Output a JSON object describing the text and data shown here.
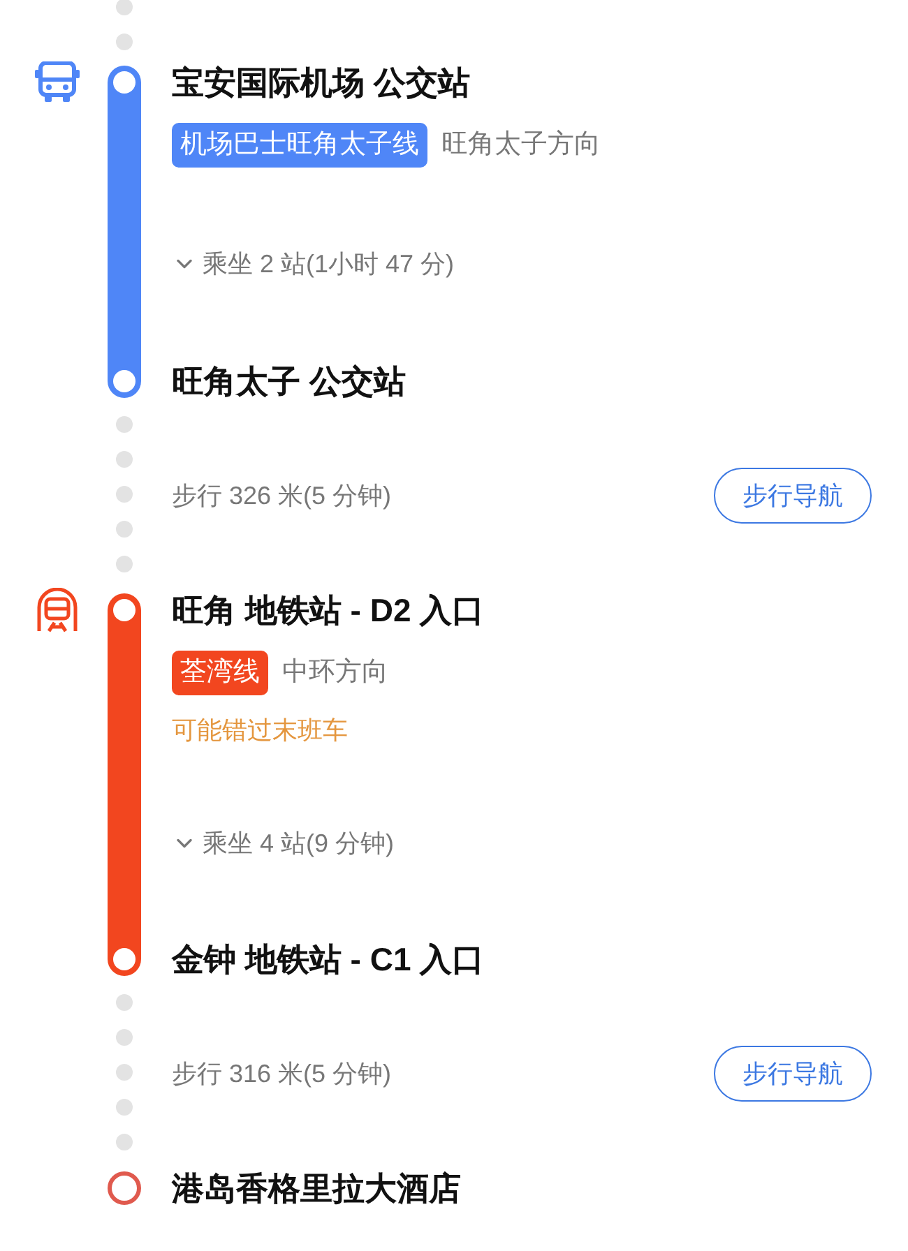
{
  "segments": [
    {
      "kind": "connector"
    },
    {
      "kind": "bus",
      "color": "#4f86f7",
      "from": "宝安国际机场 公交站",
      "line": "机场巴士旺角太子线",
      "direction": "旺角太子方向",
      "ride": "乘坐 2 站(1小时 47 分)",
      "to": "旺角太子 公交站"
    },
    {
      "kind": "walk",
      "text": "步行 326 米(5 分钟)",
      "button": "步行导航"
    },
    {
      "kind": "subway",
      "color": "#f2461f",
      "from": "旺角 地铁站 - D2 入口",
      "line": "荃湾线",
      "direction": "中环方向",
      "warning": "可能错过末班车",
      "ride": "乘坐 4 站(9 分钟)",
      "to": "金钟 地铁站 - C1 入口"
    },
    {
      "kind": "walk",
      "text": "步行 316 米(5 分钟)",
      "button": "步行导航"
    },
    {
      "kind": "destination",
      "name": "港岛香格里拉大酒店"
    }
  ]
}
